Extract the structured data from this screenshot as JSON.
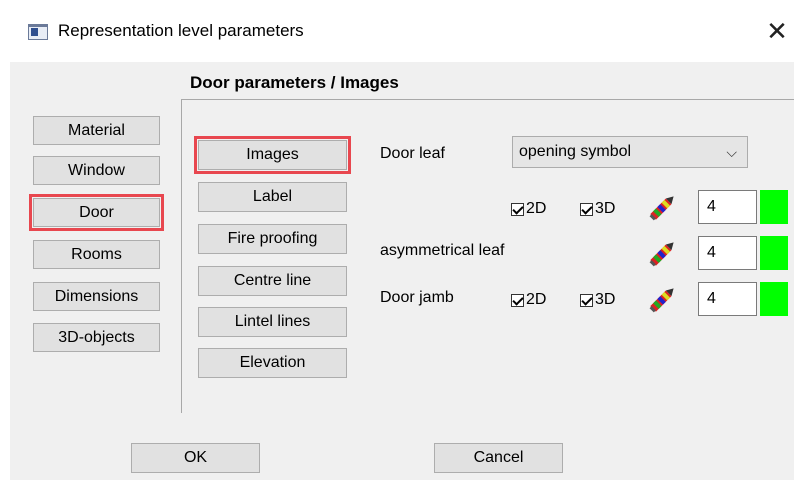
{
  "window": {
    "title": "Representation level parameters",
    "close_glyph": "✕"
  },
  "heading": "Door parameters / Images",
  "categories": [
    {
      "label": "Material",
      "selected": false
    },
    {
      "label": "Window",
      "selected": false
    },
    {
      "label": "Door",
      "selected": true
    },
    {
      "label": "Rooms",
      "selected": false
    },
    {
      "label": "Dimensions",
      "selected": false
    },
    {
      "label": "3D-objects",
      "selected": false
    }
  ],
  "subcategories": [
    {
      "label": "Images",
      "selected": true
    },
    {
      "label": "Label",
      "selected": false
    },
    {
      "label": "Fire proofing",
      "selected": false
    },
    {
      "label": "Centre line",
      "selected": false
    },
    {
      "label": "Lintel lines",
      "selected": false
    },
    {
      "label": "Elevation",
      "selected": false
    }
  ],
  "door_leaf": {
    "label": "Door leaf",
    "select_value": "opening symbol",
    "chevron": "⌵",
    "check_2d": "2D",
    "check_3d": "3D",
    "pen_icon": "color-pen-icon",
    "value": "4",
    "color": "#00ff00"
  },
  "asym_leaf": {
    "label": "asymmetrical leaf",
    "pen_icon": "color-pen-icon",
    "value": "4",
    "color": "#00ff00"
  },
  "door_jamb": {
    "label": "Door jamb",
    "check_2d": "2D",
    "check_3d": "3D",
    "pen_icon": "color-pen-icon",
    "value": "4",
    "color": "#00ff00"
  },
  "footer": {
    "ok_label": "OK",
    "cancel_label": "Cancel"
  },
  "colors": {
    "selection_outline": "#e8474f",
    "client_bg": "#f0f0f0",
    "button_bg": "#e1e1e1"
  }
}
